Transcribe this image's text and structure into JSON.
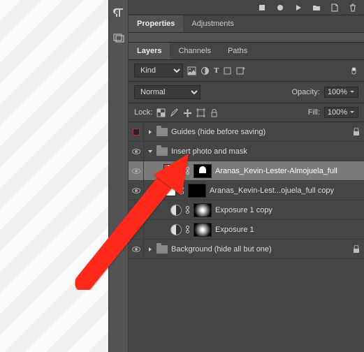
{
  "tabs_top": {
    "properties": "Properties",
    "adjustments": "Adjustments"
  },
  "tabs_layers": {
    "layers": "Layers",
    "channels": "Channels",
    "paths": "Paths"
  },
  "filter": {
    "search_prefix": "⌕",
    "kind": "Kind"
  },
  "blend": {
    "mode": "Normal",
    "opacity_label": "Opacity:",
    "opacity_value": "100%"
  },
  "lock": {
    "label": "Lock:",
    "fill_label": "Fill:",
    "fill_value": "100%"
  },
  "layers": [
    {
      "name": "Guides (hide before saving)"
    },
    {
      "name": "Insert photo and mask"
    },
    {
      "name": "Aranas_Kevin-Lester-Almojuela_full"
    },
    {
      "name": "Aranas_Kevin-Lest...ojuela_full copy"
    },
    {
      "name": "Exposure 1 copy"
    },
    {
      "name": "Exposure 1"
    },
    {
      "name": "Background (hide all but one)"
    }
  ]
}
